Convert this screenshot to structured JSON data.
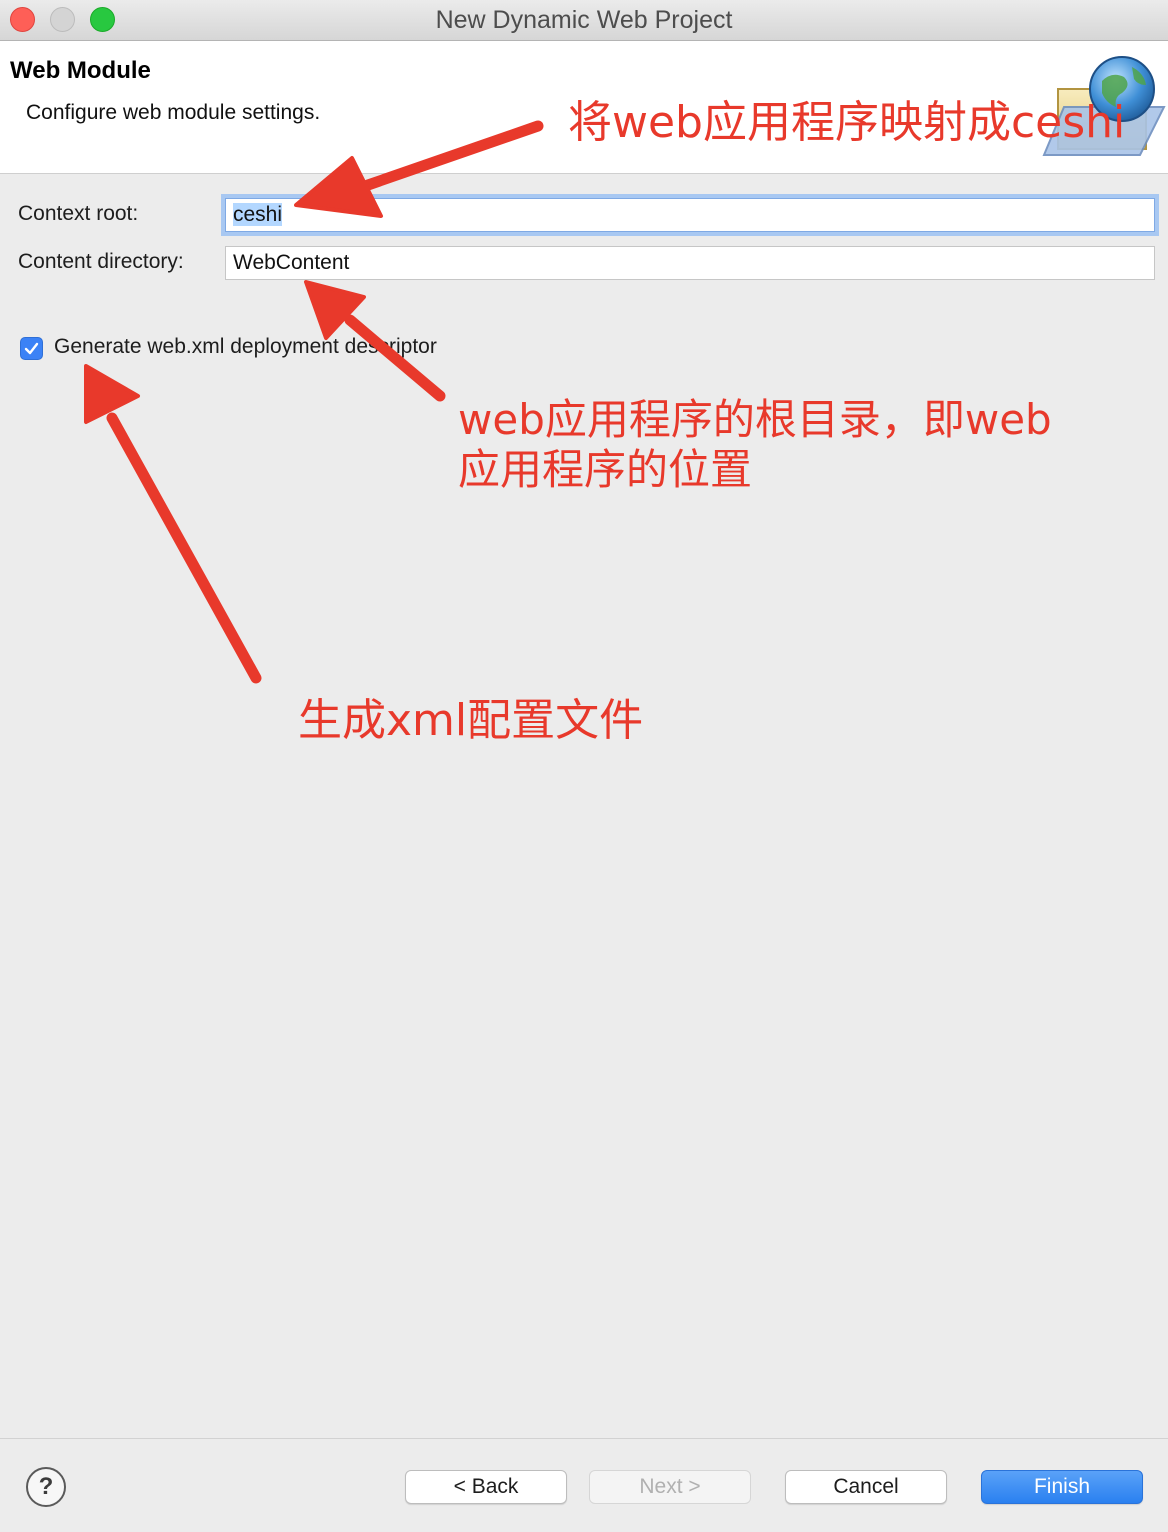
{
  "window": {
    "title": "New Dynamic Web Project"
  },
  "header": {
    "title": "Web Module",
    "description": "Configure web module settings.",
    "banner_icon": "web-project-wizard-icon"
  },
  "form": {
    "context_root": {
      "label": "Context root:",
      "value": "ceshi"
    },
    "content_directory": {
      "label": "Content directory:",
      "value": "WebContent"
    },
    "generate_descriptor": {
      "label": "Generate web.xml deployment descriptor",
      "checked": true
    }
  },
  "annotations": {
    "context_root_note": "将web应用程序映射成ceshi",
    "content_dir_note_line1": "web应用程序的根目录，即web",
    "content_dir_note_line2": "应用程序的位置",
    "descriptor_note": "生成xml配置文件",
    "color": "#e8392b"
  },
  "footer": {
    "help_label": "?",
    "back_label": "< Back",
    "next_label": "Next >",
    "cancel_label": "Cancel",
    "finish_label": "Finish"
  },
  "colors": {
    "accent": "#2a80f0",
    "annotation": "#e8392b",
    "focus_ring": "#a8c8f2"
  }
}
